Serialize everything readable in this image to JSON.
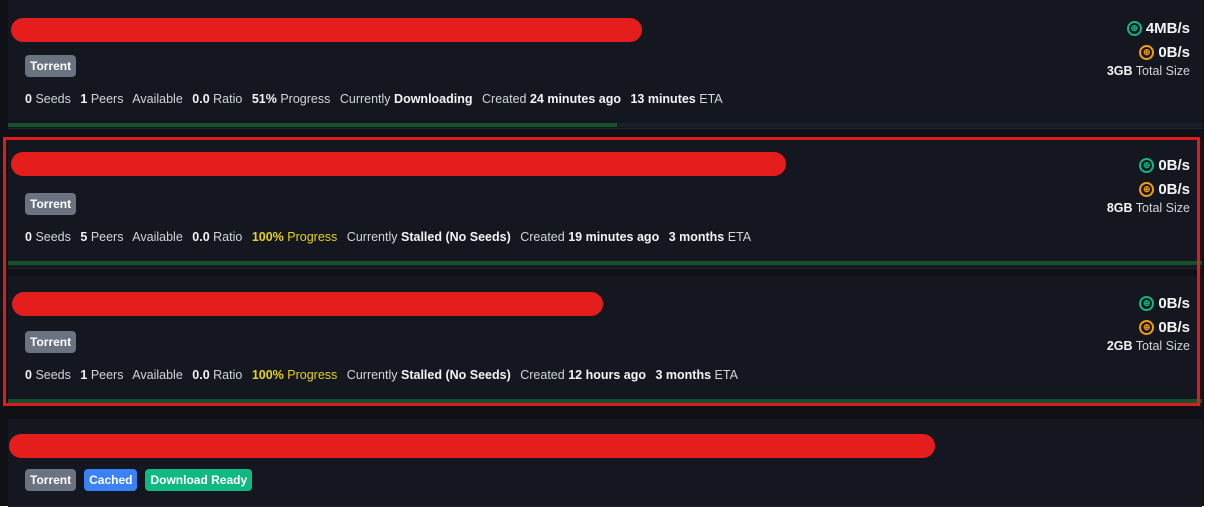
{
  "items": [
    {
      "badges": [
        "Torrent"
      ],
      "download_speed": "4MB/s",
      "upload_speed": "0B/s",
      "size_value": "3GB",
      "size_label": "Total Size",
      "seeds": "0",
      "seeds_label": "Seeds",
      "peers": "1",
      "peers_label": "Peers",
      "available_label": "Available",
      "ratio": "0.0",
      "ratio_label": "Ratio",
      "progress": "51%",
      "progress_label": "Progress",
      "currently_label": "Currently",
      "status": "Downloading",
      "created_label": "Created",
      "created": "24 minutes ago",
      "eta": "13 minutes",
      "eta_label": "ETA",
      "progress_fraction": 0.51
    },
    {
      "badges": [
        "Torrent"
      ],
      "download_speed": "0B/s",
      "upload_speed": "0B/s",
      "size_value": "8GB",
      "size_label": "Total Size",
      "seeds": "0",
      "seeds_label": "Seeds",
      "peers": "5",
      "peers_label": "Peers",
      "available_label": "Available",
      "ratio": "0.0",
      "ratio_label": "Ratio",
      "progress": "100%",
      "progress_label": "Progress",
      "currently_label": "Currently",
      "status": "Stalled (No Seeds)",
      "created_label": "Created",
      "created": "19 minutes ago",
      "eta": "3 months",
      "eta_label": "ETA",
      "progress_fraction": 1.0
    },
    {
      "badges": [
        "Torrent"
      ],
      "download_speed": "0B/s",
      "upload_speed": "0B/s",
      "size_value": "2GB",
      "size_label": "Total Size",
      "seeds": "0",
      "seeds_label": "Seeds",
      "peers": "1",
      "peers_label": "Peers",
      "available_label": "Available",
      "ratio": "0.0",
      "ratio_label": "Ratio",
      "progress": "100%",
      "progress_label": "Progress",
      "currently_label": "Currently",
      "status": "Stalled (No Seeds)",
      "created_label": "Created",
      "created": "12 hours ago",
      "eta": "3 months",
      "eta_label": "ETA",
      "progress_fraction": 1.0
    },
    {
      "badges": [
        "Torrent",
        "Cached",
        "Download Ready"
      ]
    }
  ],
  "icons": {
    "download": "download-globe-icon",
    "upload": "upload-globe-icon"
  },
  "colors": {
    "redaction": "#e51d1d",
    "highlight": "#dc1d1d",
    "progress_complete": "#e5d21a",
    "download_icon": "#10b981",
    "upload_icon": "#f59e0b"
  }
}
